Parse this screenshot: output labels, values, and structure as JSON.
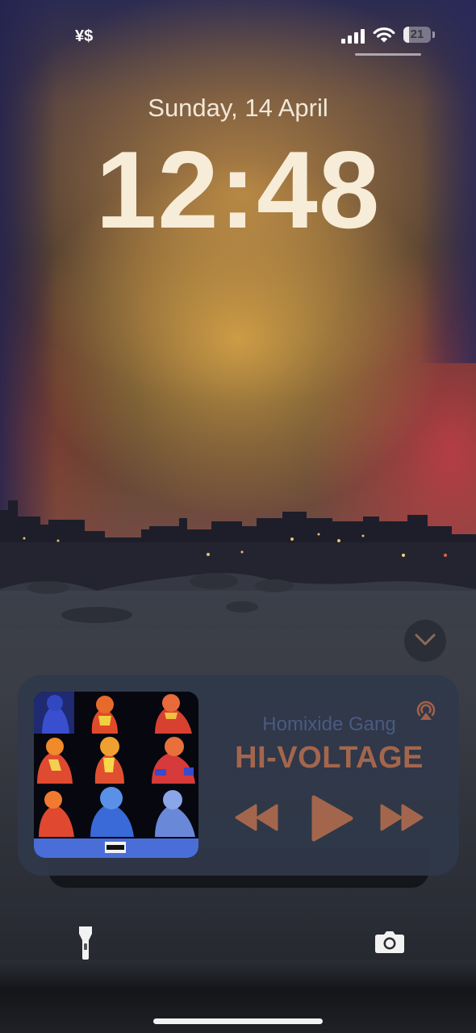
{
  "status_bar": {
    "carrier": "¥$",
    "battery_level": "21",
    "battery_fraction": 0.21
  },
  "lock_screen": {
    "date": "Sunday, 14 April",
    "time": "12:48"
  },
  "now_playing": {
    "artist": "Homixide Gang",
    "title": "HI-VOLTAGE",
    "accent_color": "#a3664d",
    "artist_color": "#4a5a82",
    "icons": {
      "airplay": "airplay-icon",
      "rewind": "rewind-icon",
      "play": "play-icon",
      "forward": "fast-forward-icon",
      "collapse": "chevron-down-icon"
    }
  },
  "shortcuts": {
    "left": "flashlight-icon",
    "right": "camera-icon"
  }
}
